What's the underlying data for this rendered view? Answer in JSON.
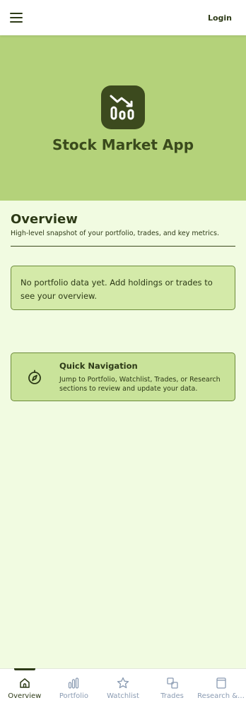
{
  "header": {
    "menu_icon": "hamburger-menu-icon",
    "login_label": "Login"
  },
  "hero": {
    "logo_icon": "stock-chart-icon",
    "title": "Stock Market App"
  },
  "overview": {
    "title": "Overview",
    "subtitle": "High-level snapshot of your portfolio, trades, and key metrics.",
    "empty_message": "No portfolio data yet. Add holdings or trades to see your overview."
  },
  "quick_nav": {
    "icon": "compass-icon",
    "title": "Quick Navigation",
    "description": "Jump to Portfolio, Watchlist, Trades, or Research sections to review and update your data."
  },
  "bottom_nav": {
    "items": [
      {
        "label": "Overview",
        "icon": "home-icon",
        "active": true
      },
      {
        "label": "Portfolio",
        "icon": "bar-chart-icon",
        "active": false
      },
      {
        "label": "Watchlist",
        "icon": "star-icon",
        "active": false
      },
      {
        "label": "Trades",
        "icon": "trades-icon",
        "active": false
      },
      {
        "label": "Research & ...",
        "icon": "notebook-icon",
        "active": false
      }
    ]
  },
  "colors": {
    "hero_bg": "#b4d27a",
    "page_bg": "#f1fbe1",
    "card_bg": "#d4eaa9",
    "primary_text": "#2d3a17",
    "inactive_nav": "#8a9bb2"
  }
}
